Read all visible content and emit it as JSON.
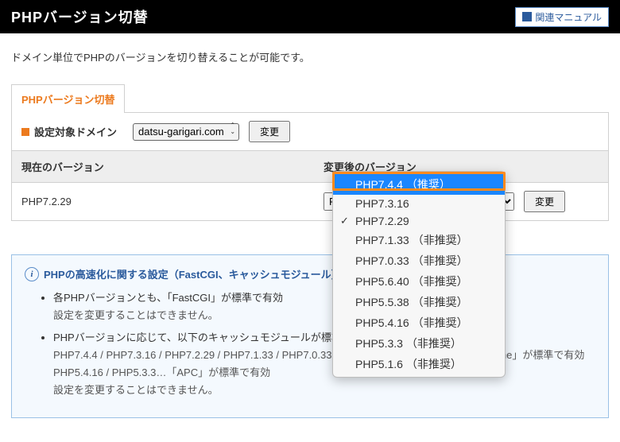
{
  "header": {
    "title": "PHPバージョン切替",
    "manual_button": "関連マニュアル"
  },
  "description": "ドメイン単位でPHPのバージョンを切り替えることが可能です。",
  "tab": {
    "label": "PHPバージョン切替"
  },
  "domain_row": {
    "label": "設定対象ドメイン",
    "selected": "datsu-garigari.com",
    "change_button": "変更"
  },
  "columns": {
    "current": "現在のバージョン",
    "after": "変更後のバージョン"
  },
  "current_version": "PHP7.2.29",
  "after_change_button": "変更",
  "dropdown": {
    "opts": [
      {
        "label": "PHP7.4.4 （推奨）",
        "hover": true
      },
      {
        "label": "PHP7.3.16"
      },
      {
        "label": "PHP7.2.29",
        "selected": true
      },
      {
        "label": "PHP7.1.33 （非推奨）"
      },
      {
        "label": "PHP7.0.33 （非推奨）"
      },
      {
        "label": "PHP5.6.40 （非推奨）"
      },
      {
        "label": "PHP5.5.38 （非推奨）"
      },
      {
        "label": "PHP5.4.16 （非推奨）"
      },
      {
        "label": "PHP5.3.3 （非推奨）"
      },
      {
        "label": "PHP5.1.6 （非推奨）"
      }
    ]
  },
  "info": {
    "title": "PHPの高速化に関する設定（FastCGI、キャッシュモジュール）は、標準で有効になります。",
    "li1a": "各PHPバージョンとも、「FastCGI」が標準で有効",
    "li1b": "設定を変更することはできません。",
    "li2a": "PHPバージョンに応じて、以下のキャッシュモジュールが標準で有効になります。",
    "li2b": "PHP7.4.4 / PHP7.3.16 / PHP7.2.29 / PHP7.1.33 / PHP7.0.33 / PHP5.6.40 / PHP5.5.38…「OPcache」が標準で有効",
    "li2c": "PHP5.4.16 / PHP5.3.3…「APC」が標準で有効",
    "li2d": "設定を変更することはできません。"
  }
}
